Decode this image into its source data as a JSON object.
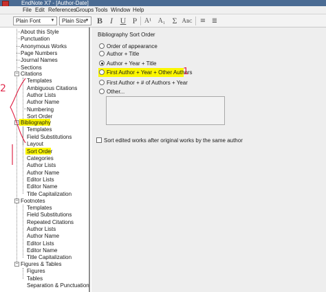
{
  "window": {
    "title": "EndNote X7 - [Author-Date]"
  },
  "menu": [
    {
      "label": "File"
    },
    {
      "label": "Edit"
    },
    {
      "label": "References"
    },
    {
      "label": "Groups"
    },
    {
      "label": "Tools"
    },
    {
      "label": "Window"
    },
    {
      "label": "Help"
    }
  ],
  "toolbar": {
    "font_value": "Plain Font",
    "size_value": "Plain Size",
    "bold": "B",
    "italic": "I",
    "underline": "U",
    "plain": "P",
    "superscript": "A¹",
    "subscript": "A₁",
    "sigma": "Σ",
    "small_caps": "Aʙᴄ"
  },
  "tree": {
    "about": "About this Style",
    "punctuation": "Punctuation",
    "anonymous_works": "Anonymous Works",
    "page_numbers": "Page Numbers",
    "journal_names": "Journal Names",
    "sections": "Sections",
    "citations": {
      "label": "Citations",
      "children": [
        "Templates",
        "Ambiguous Citations",
        "Author Lists",
        "Author Name",
        "Numbering",
        "Sort Order"
      ]
    },
    "bibliography": {
      "label": "Bibliography",
      "children": [
        "Templates",
        "Field Substitutions",
        "Layout",
        "Sort Order",
        "Categories",
        "Author Lists",
        "Author Name",
        "Editor Lists",
        "Editor Name",
        "Title Capitalization"
      ]
    },
    "footnotes": {
      "label": "Footnotes",
      "children": [
        "Templates",
        "Field Substitutions",
        "Repeated Citations",
        "Author Lists",
        "Author Name",
        "Editor Lists",
        "Editor Name",
        "Title Capitalization"
      ]
    },
    "figures_tables": {
      "label": "Figures & Tables",
      "children": [
        "Figures",
        "Tables",
        "Separation & Punctuation"
      ]
    }
  },
  "sort_panel": {
    "title": "Bibliography Sort Order",
    "options": [
      {
        "label": "Order of appearance",
        "checked": false
      },
      {
        "label": "Author + Title",
        "checked": false
      },
      {
        "label": "Author + Year + Title",
        "checked": true
      },
      {
        "label": "First Author + Year + Other Authors",
        "checked": false
      },
      {
        "label": "First Author + # of Authors + Year",
        "checked": false
      },
      {
        "label": "Other...",
        "checked": false
      }
    ],
    "checkbox_label": "Sort edited works after original works by the same author"
  },
  "annotations": {
    "mark_citations": "2",
    "mark_option": "1"
  },
  "colors": {
    "titlebar": "#4a6b93",
    "highlight": "#fbf600",
    "ink": "#e0284a"
  }
}
